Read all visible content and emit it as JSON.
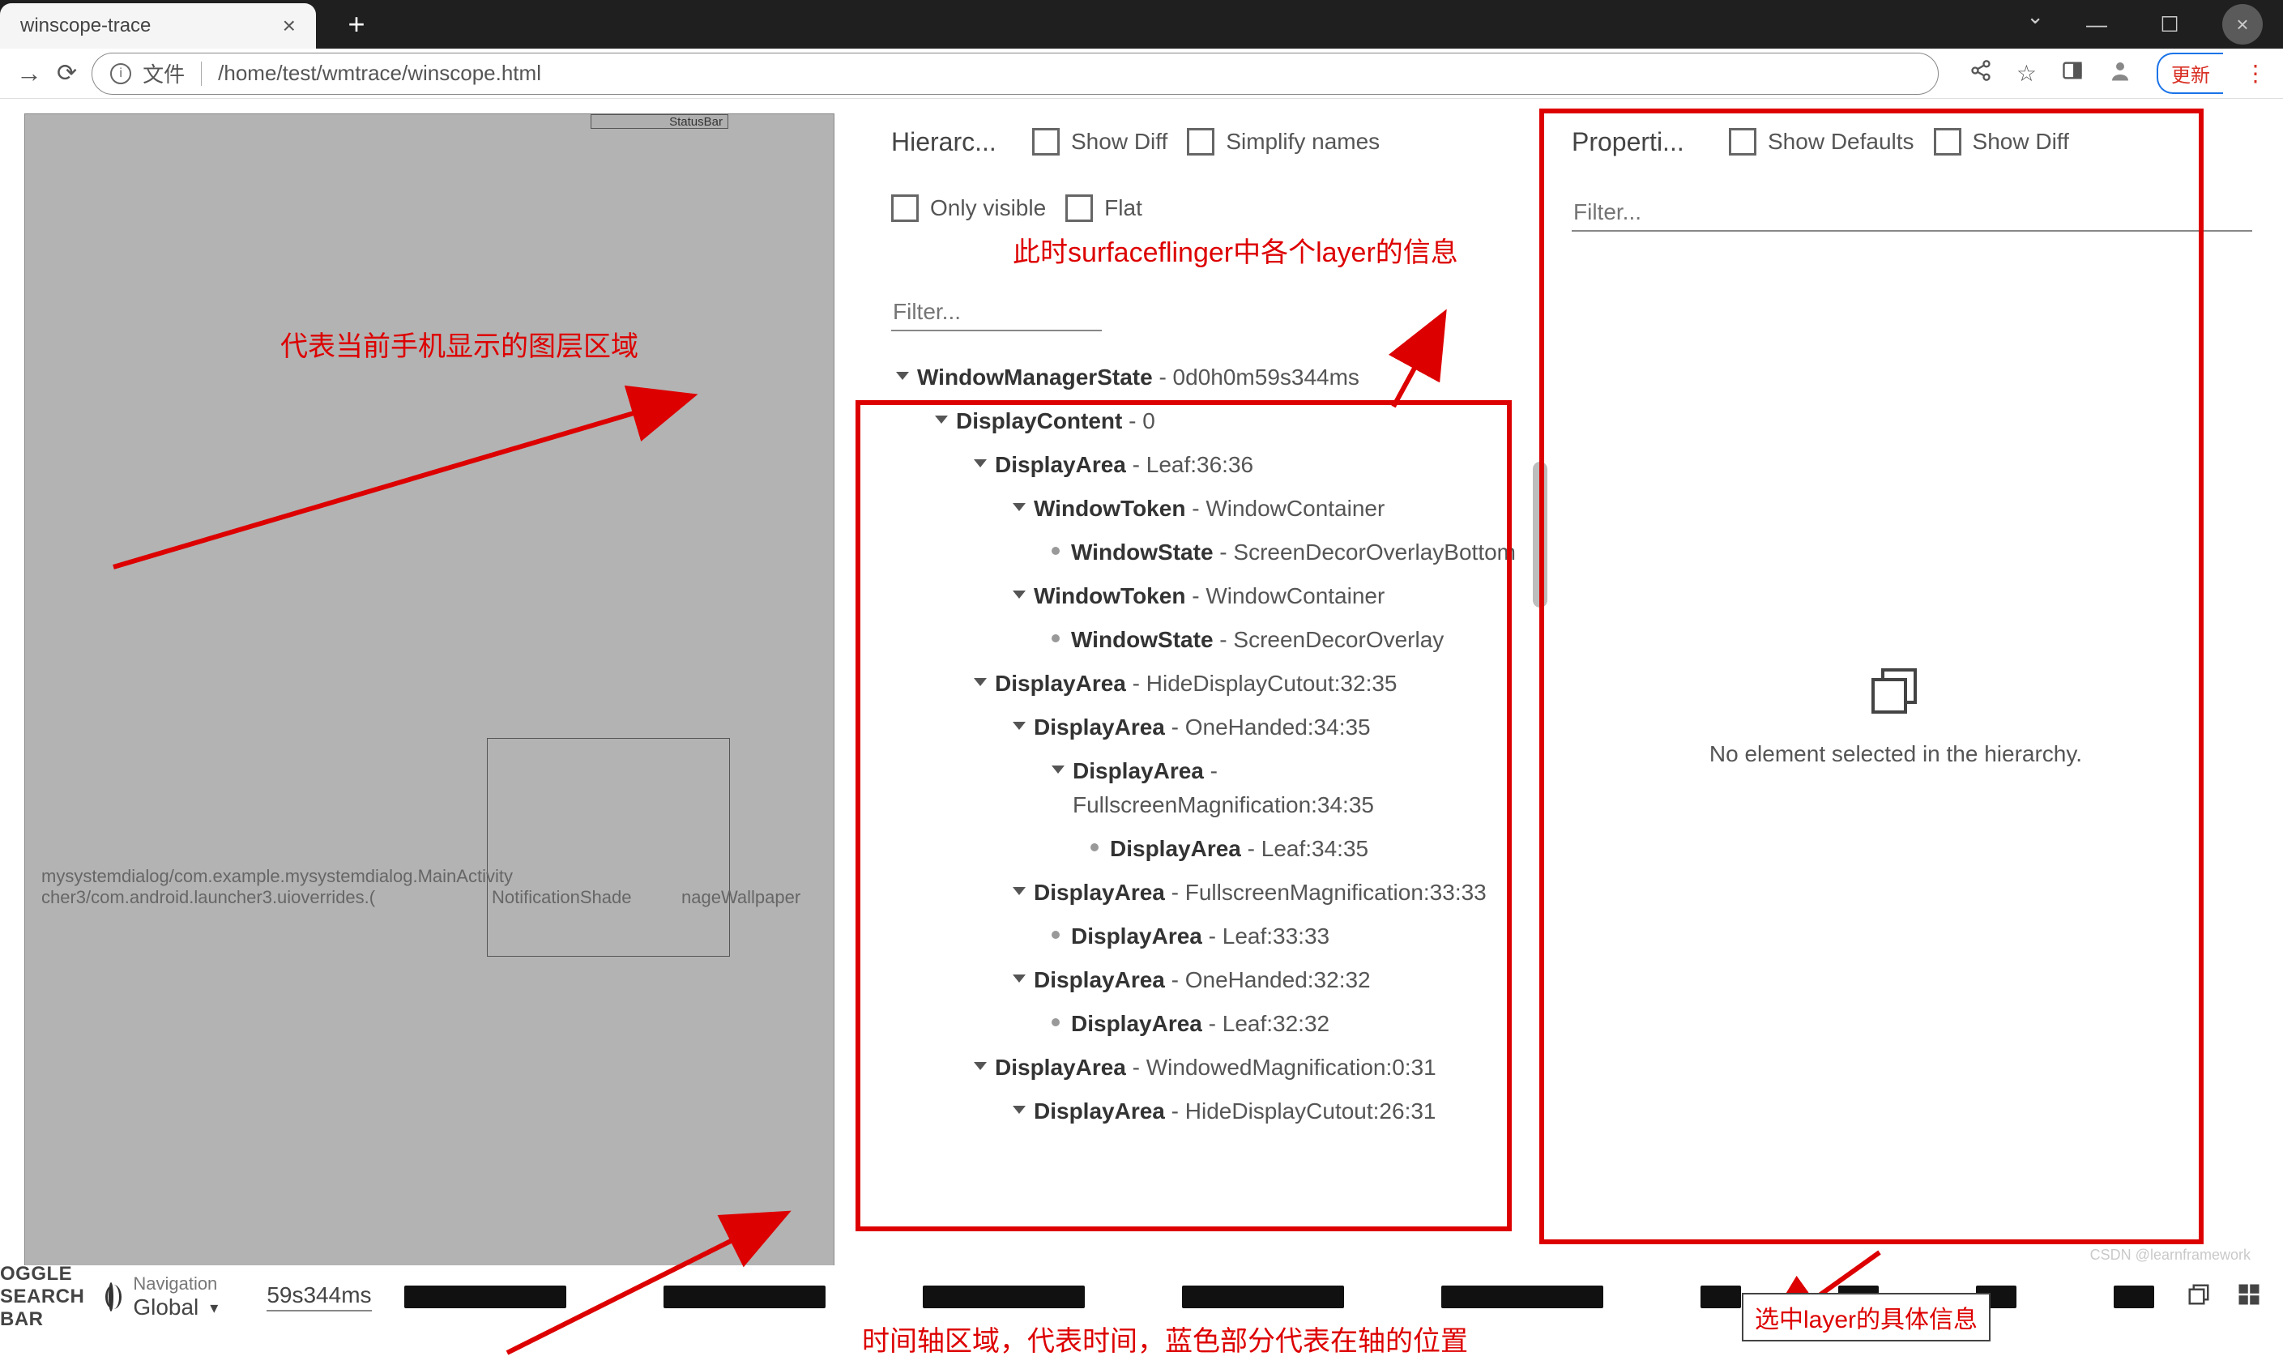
{
  "browser": {
    "tab_title": "winscope-trace",
    "url_prefix": "文件",
    "url_path": "/home/test/wmtrace/winscope.html",
    "update_btn": "更新"
  },
  "device_preview": {
    "statusbar_label": "StatusBar",
    "overlay_text_1": "mysystemdialog/com.example.mysystemdialog.MainActivity",
    "overlay_text_2": "cher3/com.android.launcher3.uioverrides.(",
    "overlay_text_3": "NotificationShade",
    "overlay_text_4": "nageWallpaper"
  },
  "hierarchy": {
    "title": "Hierarc...",
    "show_diff": "Show Diff",
    "simplify": "Simplify names",
    "only_visible": "Only visible",
    "flat": "Flat",
    "filter_placeholder": "Filter...",
    "tree": [
      {
        "d": 0,
        "c": "caret",
        "n": "WindowManagerState",
        "v": "0d0h0m59s344ms"
      },
      {
        "d": 1,
        "c": "caret",
        "n": "DisplayContent",
        "v": "0"
      },
      {
        "d": 2,
        "c": "caret",
        "n": "DisplayArea",
        "v": "Leaf:36:36"
      },
      {
        "d": 3,
        "c": "caret",
        "n": "WindowToken",
        "v": "WindowContainer"
      },
      {
        "d": 4,
        "c": "bullet",
        "n": "WindowState",
        "v": "ScreenDecorOverlayBottom"
      },
      {
        "d": 3,
        "c": "caret",
        "n": "WindowToken",
        "v": "WindowContainer"
      },
      {
        "d": 4,
        "c": "bullet",
        "n": "WindowState",
        "v": "ScreenDecorOverlay"
      },
      {
        "d": 2,
        "c": "caret",
        "n": "DisplayArea",
        "v": "HideDisplayCutout:32:35"
      },
      {
        "d": 3,
        "c": "caret",
        "n": "DisplayArea",
        "v": "OneHanded:34:35"
      },
      {
        "d": 4,
        "c": "caret",
        "n": "DisplayArea",
        "v": "FullscreenMagnification:34:35"
      },
      {
        "d": 5,
        "c": "bullet",
        "n": "DisplayArea",
        "v": "Leaf:34:35"
      },
      {
        "d": 3,
        "c": "caret",
        "n": "DisplayArea",
        "v": "FullscreenMagnification:33:33"
      },
      {
        "d": 4,
        "c": "bullet",
        "n": "DisplayArea",
        "v": "Leaf:33:33"
      },
      {
        "d": 3,
        "c": "caret",
        "n": "DisplayArea",
        "v": "OneHanded:32:32"
      },
      {
        "d": 4,
        "c": "bullet",
        "n": "DisplayArea",
        "v": "Leaf:32:32"
      },
      {
        "d": 2,
        "c": "caret",
        "n": "DisplayArea",
        "v": "WindowedMagnification:0:31"
      },
      {
        "d": 3,
        "c": "caret",
        "n": "DisplayArea",
        "v": "HideDisplayCutout:26:31"
      }
    ]
  },
  "properties": {
    "title": "Properti...",
    "show_defaults": "Show Defaults",
    "show_diff": "Show Diff",
    "filter_placeholder": "Filter...",
    "empty_text": "No element selected in the hierarchy."
  },
  "annotations": {
    "left_region": "代表当前手机显示的图层区域",
    "sf_info": "此时surfaceflinger中各个layer的信息",
    "timeline_region": "时间轴区域，代表时间，蓝色部分代表在轴的位置",
    "layer_detail": "选中layer的具体信息"
  },
  "footer": {
    "search_bar": "OGGLE SEARCH BAR",
    "nav_label": "Navigation",
    "scope": "Global",
    "time": "59s344ms",
    "blocks": [
      200,
      200,
      200,
      200,
      200,
      50,
      50,
      50,
      50
    ]
  },
  "watermark": "CSDN @learnframework"
}
